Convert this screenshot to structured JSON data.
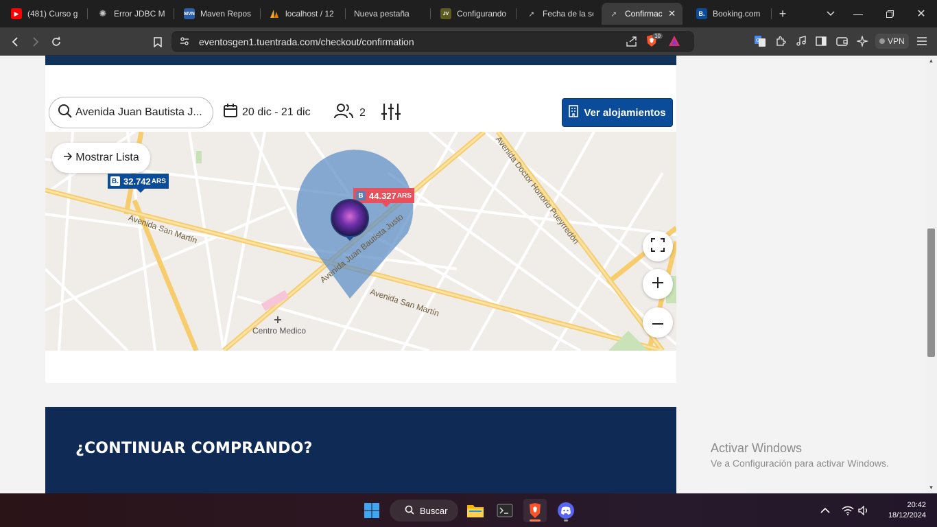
{
  "browser": {
    "tabs": [
      {
        "title": "(481) Curso gr",
        "icon": "youtube-icon",
        "color": "#ff0000"
      },
      {
        "title": "Error JDBC My",
        "icon": "openai-icon",
        "color": "#cccccc"
      },
      {
        "title": "Maven Reposi",
        "icon": "maven-icon",
        "color": "#2b5ea7"
      },
      {
        "title": "localhost / 12",
        "icon": "phpmyadmin-icon",
        "color": "#f5a623"
      },
      {
        "title": "Nueva pestaña",
        "icon": "",
        "color": ""
      },
      {
        "title": "Configurando",
        "icon": "java-icon",
        "color": "#7c7c2a"
      },
      {
        "title": "Fecha de la se",
        "icon": "arrow-icon",
        "color": "#cccccc"
      },
      {
        "title": "Confirmac",
        "icon": "arrow-icon",
        "color": "#cccccc",
        "active": true
      },
      {
        "title": "Booking.com",
        "icon": "booking-icon",
        "color": "#0b4c9a"
      }
    ],
    "url": "eventosgen1.tuentrada.com/checkout/confirmation",
    "vpn_label": "VPN",
    "brave_badge": "10"
  },
  "search": {
    "location": "Avenida Juan Bautista J...",
    "dates": "20 dic - 21 dic",
    "guests": "2",
    "cta": "Ver alojamientos"
  },
  "map": {
    "show_list": "Mostrar Lista",
    "prices": [
      {
        "brand": "B.",
        "amount": "32.742",
        "currency": "ARS",
        "color": "#0b4c9a"
      },
      {
        "brand": "B",
        "amount": "44.327",
        "currency": "ARS",
        "color": "#e8505b"
      }
    ],
    "streets": {
      "san_martin_1": "Avenida San Martín",
      "san_martin_2": "Avenida San Martín",
      "juan_b_justo": "Avenida Juan Bautista Justo",
      "pueyrredon": "Avenida Doctor Honorio Pueyrredón"
    },
    "poi": "Centro Medico"
  },
  "banner": {
    "title": "¿CONTINUAR COMPRANDO?"
  },
  "windows": {
    "activate_title": "Activar Windows",
    "activate_sub": "Ve a Configuración para activar Windows.",
    "search_label": "Buscar",
    "time": "20:42",
    "date": "18/12/2024"
  }
}
